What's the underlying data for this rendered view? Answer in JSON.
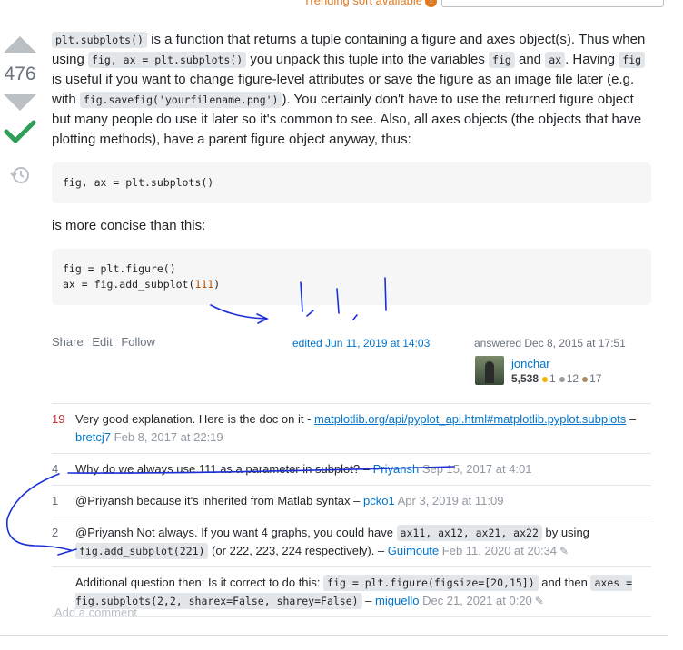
{
  "topbar": {
    "trending_label": "Trending sort available"
  },
  "vote": {
    "count": "476"
  },
  "post": {
    "p1_code1": "plt.subplots()",
    "p1_t1": " is a function that returns a tuple containing a figure and axes object(s). Thus when using ",
    "p1_code2": "fig, ax = plt.subplots()",
    "p1_t2": " you unpack this tuple into the variables ",
    "p1_code3": "fig",
    "p1_t3": " and ",
    "p1_code4": "ax",
    "p1_t4": ". Having ",
    "p1_code5": "fig",
    "p1_t5": " is useful if you want to change figure-level attributes or save the figure as an image file later (e.g. with ",
    "p1_code6": "fig.savefig('yourfilename.png')",
    "p1_t6": "). You certainly don't have to use the returned figure object but many people do use it later so it's common to see. Also, all axes objects (the objects that have plotting methods), have a parent figure object anyway, thus:",
    "code_block_1": "fig, ax = plt.subplots()",
    "p2": "is more concise than this:",
    "code_block_2_line1": "fig = plt.figure()",
    "code_block_2_line2_pre": "ax = fig.add_subplot(",
    "code_block_2_line2_num": "111",
    "code_block_2_line2_post": ")"
  },
  "post_menu": {
    "share": "Share",
    "edit": "Edit",
    "follow": "Follow"
  },
  "edited": "edited Jun 11, 2019 at 14:03",
  "answered": "answered Dec 8, 2015 at 17:51",
  "user": {
    "name": "jonchar",
    "rep": "5,538",
    "gold": "1",
    "silver": "12",
    "bronze": "17"
  },
  "comments": [
    {
      "score": "19",
      "text": "Very good explanation. Here is the doc on it - ",
      "link": "matplotlib.org/api/pyplot_api.html#matplotlib.pyplot.subplots",
      "user": "bretcj7",
      "date": "Feb 8, 2017 at 22:19"
    },
    {
      "score": "4",
      "text": "Why do we always use 111 as a parameter in subplot?",
      "user": "Priyansh",
      "date": "Sep 15, 2017 at 4:01"
    },
    {
      "score": "1",
      "text": "@Priyansh because it's inherited from Matlab syntax",
      "user": "pcko1",
      "date": "Apr 3, 2019 at 11:09"
    },
    {
      "score": "2",
      "text_pre": "@Priyansh Not always. If you want 4 graphs, you could have ",
      "code1": "ax11, ax12, ax21, ax22",
      "text_mid": " by using ",
      "code2": "fig.add_subplot(221)",
      "text_post": " (or 222, 223, 224 respectively).",
      "user": "Guimoute",
      "date": "Feb 11, 2020 at 20:34"
    },
    {
      "score": "",
      "text_pre": "Additional question then: Is it correct to do this: ",
      "code1": "fig = plt.figure(figsize=[20,15])",
      "text_mid": " and then ",
      "code2": "axes = fig.subplots(2,2, sharex=False, sharey=False)",
      "user": "miguello",
      "date": "Dec 21, 2021 at 0:20"
    }
  ],
  "add_comment": "Add a comment",
  "colors": {
    "link": "#0074cc",
    "accepted": "#2f6f44",
    "ink": "#1a2fd6"
  }
}
